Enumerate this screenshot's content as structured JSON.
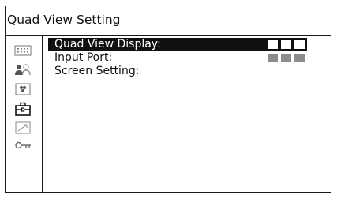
{
  "window": {
    "title": "Quad View Setting"
  },
  "sidebar": {
    "icons": [
      "status-icon",
      "users-icon",
      "camera-icon",
      "toolbox-icon",
      "chart-arrow-icon",
      "key-icon"
    ]
  },
  "menu": {
    "items": [
      {
        "label": "Quad View Display:",
        "value_boxes": 3,
        "selected": true
      },
      {
        "label": "Input Port:",
        "value_boxes": 3,
        "selected": false
      },
      {
        "label": "Screen Setting:",
        "value_boxes": 0,
        "selected": false
      }
    ]
  },
  "colors": {
    "selected_bg": "#101010",
    "value_grey": "#8c8c8c",
    "border": "#1a1a1a"
  }
}
